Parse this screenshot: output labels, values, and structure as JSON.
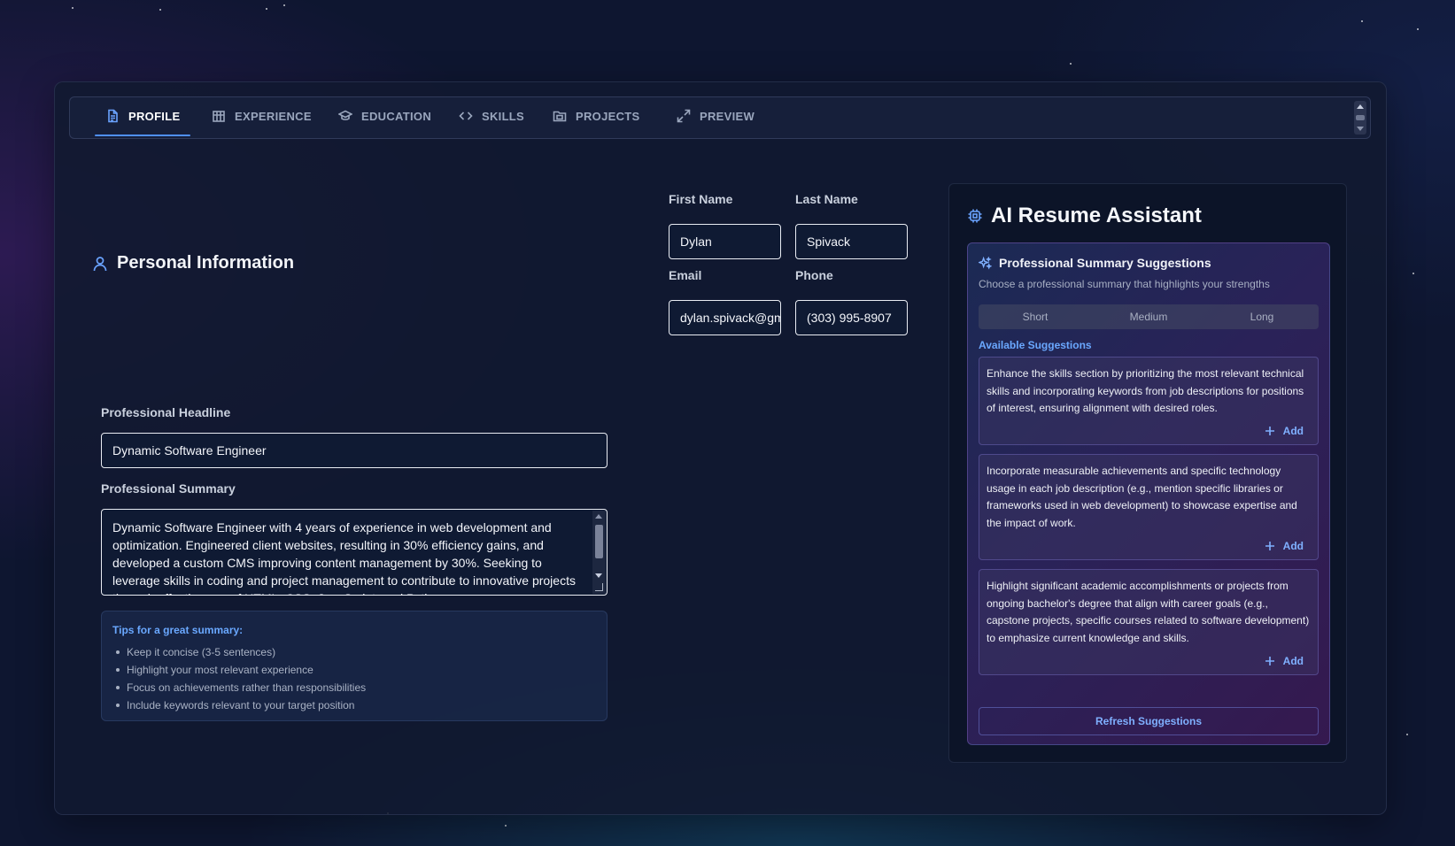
{
  "tabs": [
    {
      "label": "PROFILE",
      "icon": "document-icon",
      "active": true
    },
    {
      "label": "EXPERIENCE",
      "icon": "building-icon",
      "active": false
    },
    {
      "label": "EDUCATION",
      "icon": "graduation-cap-icon",
      "active": false
    },
    {
      "label": "SKILLS",
      "icon": "code-icon",
      "active": false
    },
    {
      "label": "PROJECTS",
      "icon": "folder-icon",
      "active": false
    },
    {
      "label": "PREVIEW",
      "icon": "expand-icon",
      "active": false
    }
  ],
  "profile": {
    "section_title": "Personal Information",
    "first_name": {
      "label": "First Name",
      "value": "Dylan"
    },
    "last_name": {
      "label": "Last Name",
      "value": "Spivack"
    },
    "email": {
      "label": "Email",
      "value": "dylan.spivack@gmail.com"
    },
    "phone": {
      "label": "Phone",
      "value": "(303) 995-8907"
    },
    "headline": {
      "label": "Professional Headline",
      "value": "Dynamic Software Engineer"
    },
    "summary": {
      "label": "Professional Summary",
      "value": "Dynamic Software Engineer with 4 years of experience in web development and optimization. Engineered client websites, resulting in 30% efficiency gains, and developed a custom CMS improving content management by 30%. Seeking to leverage skills in coding and project management to contribute to innovative projects through effective use of HTML, CSS, JavaScript, and Python."
    },
    "tips": {
      "title": "Tips for a great summary:",
      "items": [
        "Keep it concise (3-5 sentences)",
        "Highlight your most relevant experience",
        "Focus on achievements rather than responsibilities",
        "Include keywords relevant to your target position"
      ]
    }
  },
  "assistant": {
    "title": "AI Resume Assistant",
    "suggestions_title": "Professional Summary Suggestions",
    "suggestions_subtitle": "Choose a professional summary that highlights your strengths",
    "length_options": [
      "Short",
      "Medium",
      "Long"
    ],
    "available_label": "Available Suggestions",
    "add_label": "Add",
    "cards": [
      "Enhance the skills section by prioritizing the most relevant technical skills and incorporating keywords from job descriptions for positions of interest, ensuring alignment with desired roles.",
      "Incorporate measurable achievements and specific technology usage in each job description (e.g., mention specific libraries or frameworks used in web development) to showcase expertise and the impact of work.",
      "Highlight significant academic accomplishments or projects from ongoing bachelor's degree that align with career goals (e.g., capstone projects, specific courses related to software development) to emphasize current knowledge and skills."
    ],
    "refresh_label": "Refresh Suggestions"
  },
  "colors": {
    "accent": "#4f8ff7",
    "link": "#6aa8ff",
    "background": "#0e1630"
  }
}
